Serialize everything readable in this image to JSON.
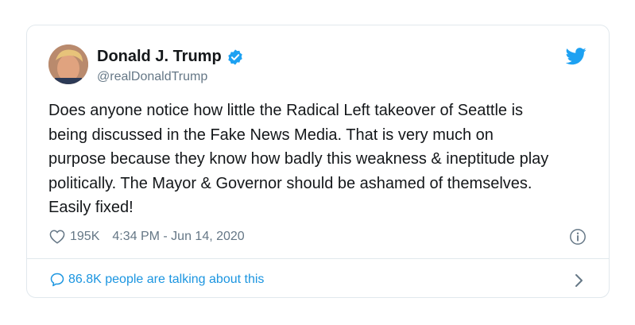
{
  "tweet": {
    "author_name": "Donald J. Trump",
    "handle": "@realDonaldTrump",
    "text": "Does anyone notice how little the Radical Left takeover of Seattle is\nbeing discussed in the Fake News Media. That is very much on\npurpose because they know how badly this weakness & ineptitude play\npolitically. The Mayor & Governor should be ashamed of themselves.\nEasily fixed!",
    "likes": "195K",
    "timestamp": "4:34 PM - Jun 14, 2020",
    "talking_about": "86.8K people are talking about this"
  },
  "colors": {
    "accent": "#1da1f2",
    "link": "#1b95e0",
    "secondary_text": "#657786",
    "border": "#e1e8ed"
  },
  "icons": [
    "verified-badge-icon",
    "twitter-bird-icon",
    "heart-icon",
    "info-icon",
    "speech-bubble-icon",
    "chevron-right-icon"
  ]
}
